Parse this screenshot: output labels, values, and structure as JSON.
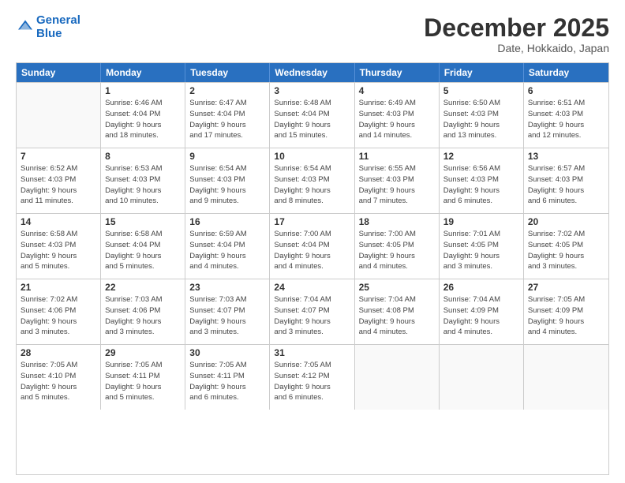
{
  "logo": {
    "line1": "General",
    "line2": "Blue"
  },
  "header": {
    "month": "December 2025",
    "location": "Date, Hokkaido, Japan"
  },
  "weekdays": [
    "Sunday",
    "Monday",
    "Tuesday",
    "Wednesday",
    "Thursday",
    "Friday",
    "Saturday"
  ],
  "rows": [
    [
      {
        "day": "",
        "info": ""
      },
      {
        "day": "1",
        "info": "Sunrise: 6:46 AM\nSunset: 4:04 PM\nDaylight: 9 hours\nand 18 minutes."
      },
      {
        "day": "2",
        "info": "Sunrise: 6:47 AM\nSunset: 4:04 PM\nDaylight: 9 hours\nand 17 minutes."
      },
      {
        "day": "3",
        "info": "Sunrise: 6:48 AM\nSunset: 4:04 PM\nDaylight: 9 hours\nand 15 minutes."
      },
      {
        "day": "4",
        "info": "Sunrise: 6:49 AM\nSunset: 4:03 PM\nDaylight: 9 hours\nand 14 minutes."
      },
      {
        "day": "5",
        "info": "Sunrise: 6:50 AM\nSunset: 4:03 PM\nDaylight: 9 hours\nand 13 minutes."
      },
      {
        "day": "6",
        "info": "Sunrise: 6:51 AM\nSunset: 4:03 PM\nDaylight: 9 hours\nand 12 minutes."
      }
    ],
    [
      {
        "day": "7",
        "info": "Sunrise: 6:52 AM\nSunset: 4:03 PM\nDaylight: 9 hours\nand 11 minutes."
      },
      {
        "day": "8",
        "info": "Sunrise: 6:53 AM\nSunset: 4:03 PM\nDaylight: 9 hours\nand 10 minutes."
      },
      {
        "day": "9",
        "info": "Sunrise: 6:54 AM\nSunset: 4:03 PM\nDaylight: 9 hours\nand 9 minutes."
      },
      {
        "day": "10",
        "info": "Sunrise: 6:54 AM\nSunset: 4:03 PM\nDaylight: 9 hours\nand 8 minutes."
      },
      {
        "day": "11",
        "info": "Sunrise: 6:55 AM\nSunset: 4:03 PM\nDaylight: 9 hours\nand 7 minutes."
      },
      {
        "day": "12",
        "info": "Sunrise: 6:56 AM\nSunset: 4:03 PM\nDaylight: 9 hours\nand 6 minutes."
      },
      {
        "day": "13",
        "info": "Sunrise: 6:57 AM\nSunset: 4:03 PM\nDaylight: 9 hours\nand 6 minutes."
      }
    ],
    [
      {
        "day": "14",
        "info": "Sunrise: 6:58 AM\nSunset: 4:03 PM\nDaylight: 9 hours\nand 5 minutes."
      },
      {
        "day": "15",
        "info": "Sunrise: 6:58 AM\nSunset: 4:04 PM\nDaylight: 9 hours\nand 5 minutes."
      },
      {
        "day": "16",
        "info": "Sunrise: 6:59 AM\nSunset: 4:04 PM\nDaylight: 9 hours\nand 4 minutes."
      },
      {
        "day": "17",
        "info": "Sunrise: 7:00 AM\nSunset: 4:04 PM\nDaylight: 9 hours\nand 4 minutes."
      },
      {
        "day": "18",
        "info": "Sunrise: 7:00 AM\nSunset: 4:05 PM\nDaylight: 9 hours\nand 4 minutes."
      },
      {
        "day": "19",
        "info": "Sunrise: 7:01 AM\nSunset: 4:05 PM\nDaylight: 9 hours\nand 3 minutes."
      },
      {
        "day": "20",
        "info": "Sunrise: 7:02 AM\nSunset: 4:05 PM\nDaylight: 9 hours\nand 3 minutes."
      }
    ],
    [
      {
        "day": "21",
        "info": "Sunrise: 7:02 AM\nSunset: 4:06 PM\nDaylight: 9 hours\nand 3 minutes."
      },
      {
        "day": "22",
        "info": "Sunrise: 7:03 AM\nSunset: 4:06 PM\nDaylight: 9 hours\nand 3 minutes."
      },
      {
        "day": "23",
        "info": "Sunrise: 7:03 AM\nSunset: 4:07 PM\nDaylight: 9 hours\nand 3 minutes."
      },
      {
        "day": "24",
        "info": "Sunrise: 7:04 AM\nSunset: 4:07 PM\nDaylight: 9 hours\nand 3 minutes."
      },
      {
        "day": "25",
        "info": "Sunrise: 7:04 AM\nSunset: 4:08 PM\nDaylight: 9 hours\nand 4 minutes."
      },
      {
        "day": "26",
        "info": "Sunrise: 7:04 AM\nSunset: 4:09 PM\nDaylight: 9 hours\nand 4 minutes."
      },
      {
        "day": "27",
        "info": "Sunrise: 7:05 AM\nSunset: 4:09 PM\nDaylight: 9 hours\nand 4 minutes."
      }
    ],
    [
      {
        "day": "28",
        "info": "Sunrise: 7:05 AM\nSunset: 4:10 PM\nDaylight: 9 hours\nand 5 minutes."
      },
      {
        "day": "29",
        "info": "Sunrise: 7:05 AM\nSunset: 4:11 PM\nDaylight: 9 hours\nand 5 minutes."
      },
      {
        "day": "30",
        "info": "Sunrise: 7:05 AM\nSunset: 4:11 PM\nDaylight: 9 hours\nand 6 minutes."
      },
      {
        "day": "31",
        "info": "Sunrise: 7:05 AM\nSunset: 4:12 PM\nDaylight: 9 hours\nand 6 minutes."
      },
      {
        "day": "",
        "info": ""
      },
      {
        "day": "",
        "info": ""
      },
      {
        "day": "",
        "info": ""
      }
    ]
  ]
}
